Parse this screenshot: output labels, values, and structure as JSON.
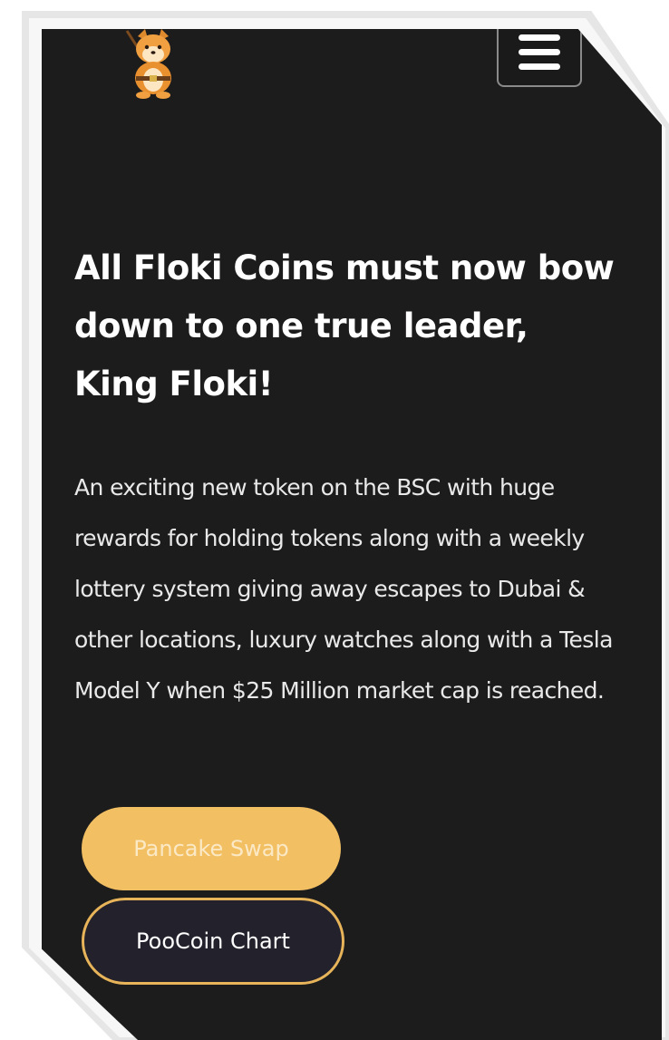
{
  "header": {
    "logo_icon": "shiba-inu-mascot-icon",
    "menu_icon": "hamburger-menu-icon"
  },
  "hero": {
    "headline": "All Floki Coins must now bow down to one true leader, King Floki!",
    "description": "An exciting new token on the BSC with huge rewards for holding tokens along with a weekly lottery system giving away escapes to Dubai & other locations, luxury watches along with a Tesla Model Y when $25 Million market cap is reached."
  },
  "buttons": {
    "pancake_swap": "Pancake Swap",
    "poocoin_chart": "PooCoin Chart"
  },
  "colors": {
    "background": "#1d1c1c",
    "accent": "#f2bf63",
    "secondary_button": "#23212c",
    "text": "#ffffff"
  }
}
